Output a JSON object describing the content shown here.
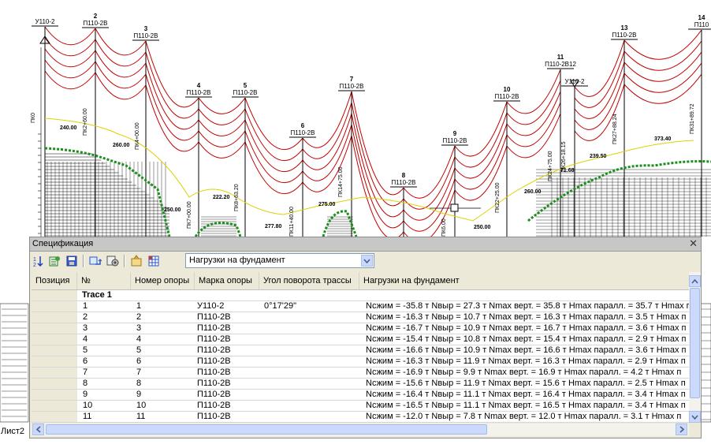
{
  "drawing": {
    "supports": [
      {
        "num": "",
        "type": "У110-2",
        "rotation": ""
      },
      {
        "num": "2",
        "type": "П110-2В",
        "rotation": ""
      },
      {
        "num": "3",
        "type": "П110-2В",
        "rotation": ""
      },
      {
        "num": "4",
        "type": "П110-2В",
        "rotation": ""
      },
      {
        "num": "5",
        "type": "П110-2В",
        "rotation": ""
      },
      {
        "num": "6",
        "type": "П110-2В",
        "rotation": ""
      },
      {
        "num": "7",
        "type": "П110-2В",
        "rotation": ""
      },
      {
        "num": "8",
        "type": "П110-2В",
        "rotation": ""
      },
      {
        "num": "9",
        "type": "П110-2В",
        "rotation": ""
      },
      {
        "num": "10",
        "type": "П110-2В",
        "rotation": ""
      },
      {
        "num": "11",
        "type": "П110-2В12",
        "rotation": ""
      },
      {
        "num": "",
        "type": "У110-2",
        "rotation": ""
      },
      {
        "num": "13",
        "type": "П110-2В",
        "rotation": ""
      },
      {
        "num": "14",
        "type": "П110",
        "rotation": ""
      }
    ],
    "elevations": [
      "240.00",
      "260.00",
      "250.00",
      "222.20",
      "277.80",
      "275.00",
      "250.00",
      "260.00",
      "239.50",
      "373.40",
      "71.68"
    ],
    "pickets": [
      "ПК0",
      "ПК2+60.00",
      "ПК4+00.00",
      "ПК7+00.00",
      "ПК8+63.20",
      "ПК11+40.00",
      "ПК14+75.00",
      "ПК22+25.00",
      "ПК24+75.00",
      "ПК26+18.15",
      "ПК27+88.24",
      "ПК31+89.72",
      "ПК6.00"
    ]
  },
  "sheet_tab": "Лист2",
  "panel": {
    "title": "Спецификация",
    "toolbar": {
      "icons": [
        "sort-icon",
        "refresh-icon",
        "save-icon",
        "swap-icon",
        "settings-icon",
        "export-icon",
        "table-icon"
      ],
      "filter_value": "Нагрузки на фундамент"
    },
    "columns": [
      "Позиция",
      "№",
      "Номер опоры",
      "Марка опоры",
      "Угол поворота трассы",
      "Нагрузки на фундамент"
    ],
    "group": "Trace 1",
    "rows": [
      {
        "n": "1",
        "num": "1",
        "mark": "У110-2",
        "angle": "0°17'29\"",
        "loads": "Nсжим = -35.8 т Nвыр = 27.3 т Nmax верт. = 35.8 т Hmax паралл. = 35.7 т Hmax п"
      },
      {
        "n": "2",
        "num": "2",
        "mark": "П110-2В",
        "angle": "",
        "loads": "Nсжим = -16.3 т Nвыр = 10.7 т Nmax верт. = 16.3 т Hmax паралл. = 3.5 т Hmax п"
      },
      {
        "n": "3",
        "num": "3",
        "mark": "П110-2В",
        "angle": "",
        "loads": "Nсжим = -16.7 т Nвыр = 10.9 т Nmax верт. = 16.7 т Hmax паралл. = 3.6 т Hmax п"
      },
      {
        "n": "4",
        "num": "4",
        "mark": "П110-2В",
        "angle": "",
        "loads": "Nсжим = -15.4 т Nвыр = 10.8 т Nmax верт. = 15.4 т Hmax паралл. = 2.9 т Hmax п"
      },
      {
        "n": "5",
        "num": "5",
        "mark": "П110-2В",
        "angle": "",
        "loads": "Nсжим = -16.6 т Nвыр = 10.9 т Nmax верт. = 16.6 т Hmax паралл. = 3.6 т Hmax п"
      },
      {
        "n": "6",
        "num": "6",
        "mark": "П110-2В",
        "angle": "",
        "loads": "Nсжим = -16.3 т Nвыр = 11.9 т Nmax верт. = 16.3 т Hmax паралл. = 2.9 т Hmax п"
      },
      {
        "n": "7",
        "num": "7",
        "mark": "П110-2В",
        "angle": "",
        "loads": "Nсжим = -16.9 т Nвыр = 9.9 т Nmax верт. = 16.9 т Hmax паралл. = 4.2 т Hmax п"
      },
      {
        "n": "8",
        "num": "8",
        "mark": "П110-2В",
        "angle": "",
        "loads": "Nсжим = -15.6 т Nвыр = 11.9 т Nmax верт. = 15.6 т Hmax паралл. = 2.5 т Hmax п"
      },
      {
        "n": "9",
        "num": "9",
        "mark": "П110-2В",
        "angle": "",
        "loads": "Nсжим = -16.4 т Nвыр = 11.1 т Nmax верт. = 16.4 т Hmax паралл. = 3.4 т Hmax п"
      },
      {
        "n": "10",
        "num": "10",
        "mark": "П110-2В",
        "angle": "",
        "loads": "Nсжим = -16.5 т Nвыр = 11.1 т Nmax верт. = 16.5 т Hmax паралл. = 3.4 т Hmax п"
      },
      {
        "n": "11",
        "num": "11",
        "mark": "П110-2В",
        "angle": "",
        "loads": "Nсжим = -12.0 т Nвыр = 7.8 т Nmax верт. = 12.0 т Hmax паралл. = 3.1 т Hmax п"
      }
    ]
  },
  "colors": {
    "wire": "#c00000",
    "ground": "#1a8f1a",
    "yellow": "#e0d000",
    "panel_bg": "#ece9d8",
    "title_bg": "#c7c7c7"
  }
}
